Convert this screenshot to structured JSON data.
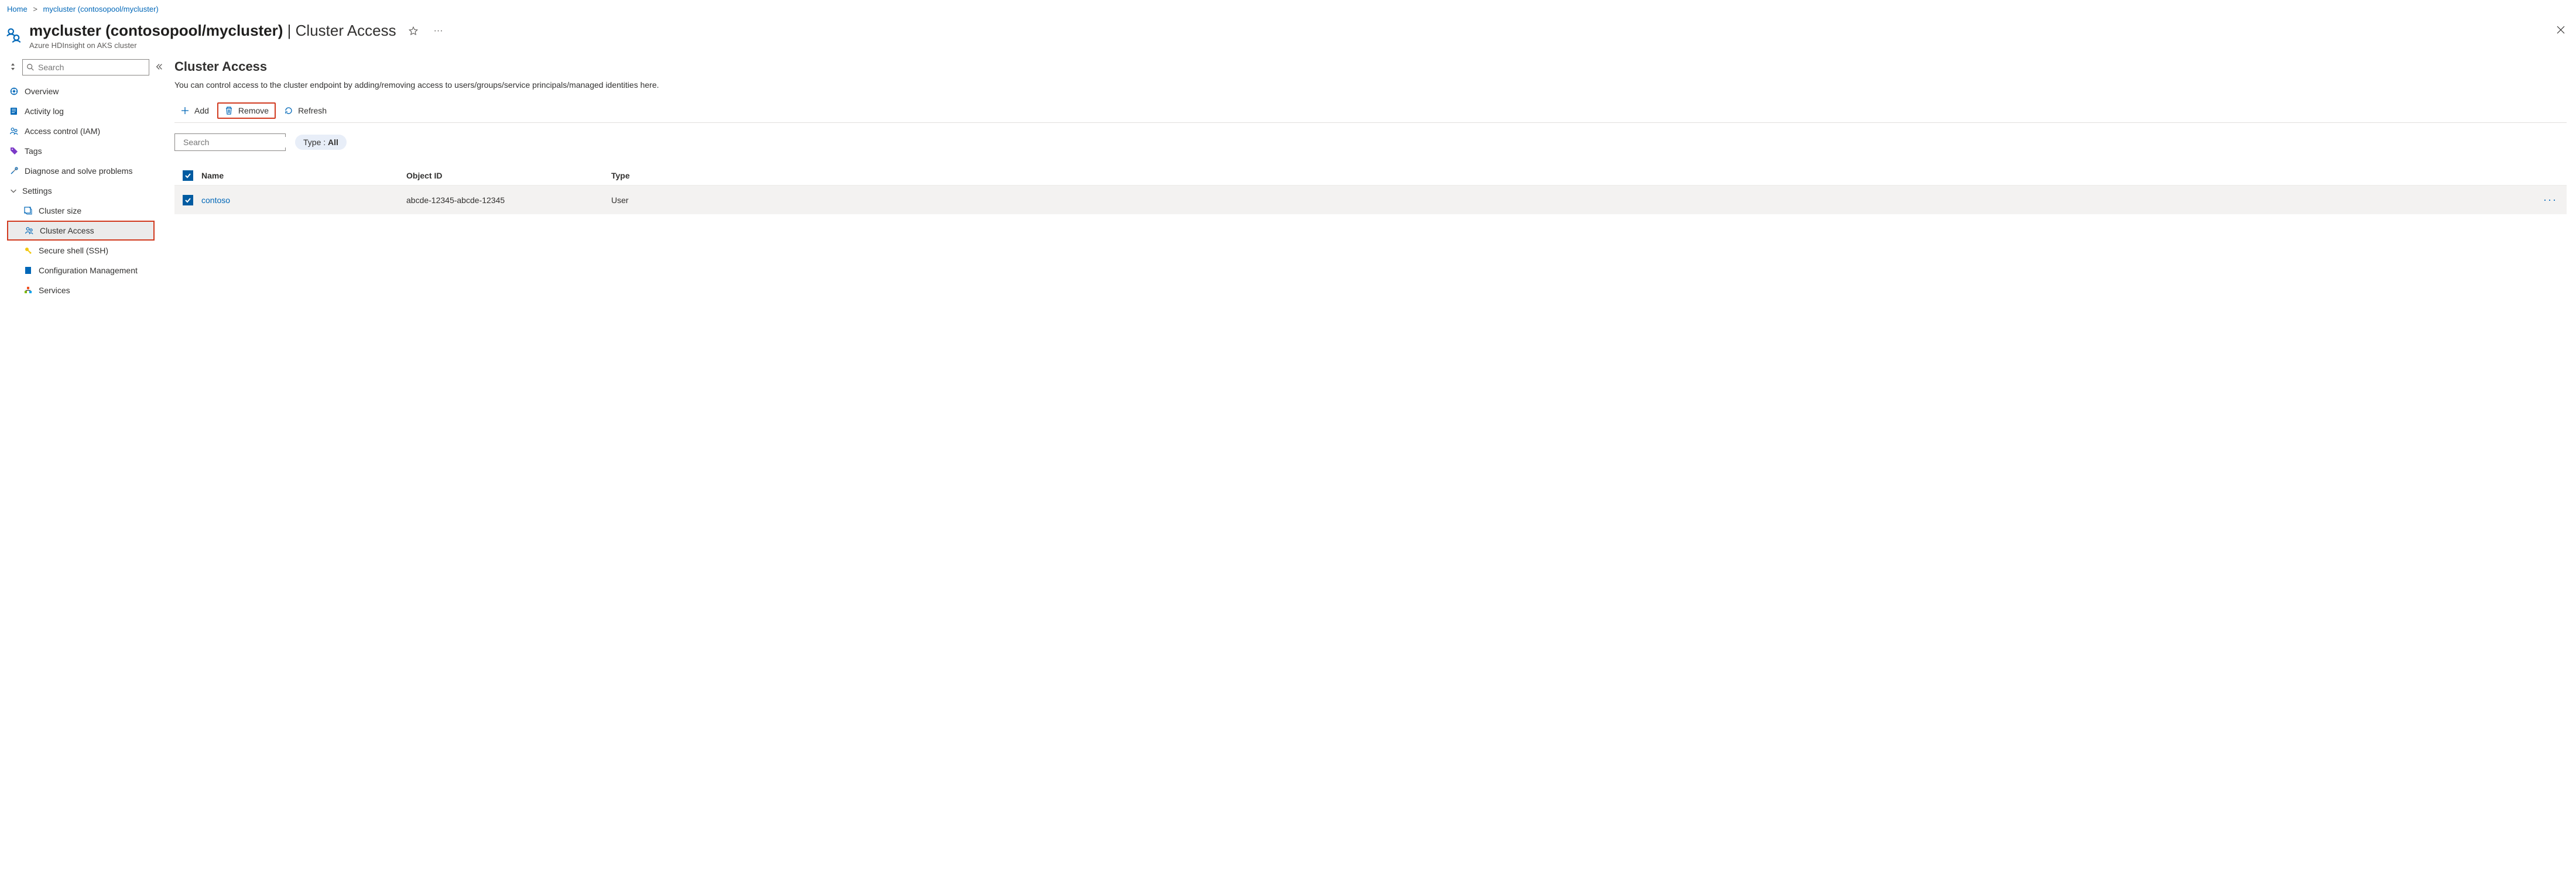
{
  "breadcrumb": {
    "home": "Home",
    "current": "mycluster (contosopool/mycluster)"
  },
  "header": {
    "title_main": "mycluster (contosopool/mycluster)",
    "title_section": "Cluster Access",
    "subtitle": "Azure HDInsight on AKS cluster"
  },
  "sidebar": {
    "search_placeholder": "Search",
    "items": {
      "overview": "Overview",
      "activity": "Activity log",
      "iam": "Access control (IAM)",
      "tags": "Tags",
      "diagnose": "Diagnose and solve problems"
    },
    "settings_label": "Settings",
    "settings": {
      "cluster_size": "Cluster size",
      "cluster_access": "Cluster Access",
      "ssh": "Secure shell (SSH)",
      "config": "Configuration Management",
      "services": "Services"
    }
  },
  "main": {
    "title": "Cluster Access",
    "description": "You can control access to the cluster endpoint by adding/removing access to users/groups/service principals/managed identities here.",
    "toolbar": {
      "add": "Add",
      "remove": "Remove",
      "refresh": "Refresh"
    },
    "search_placeholder": "Search",
    "filter_label": "Type : ",
    "filter_value": "All",
    "table": {
      "cols": {
        "name": "Name",
        "oid": "Object ID",
        "type": "Type"
      },
      "rows": [
        {
          "name": "contoso",
          "oid": "abcde-12345-abcde-12345",
          "type": "User"
        }
      ]
    }
  }
}
